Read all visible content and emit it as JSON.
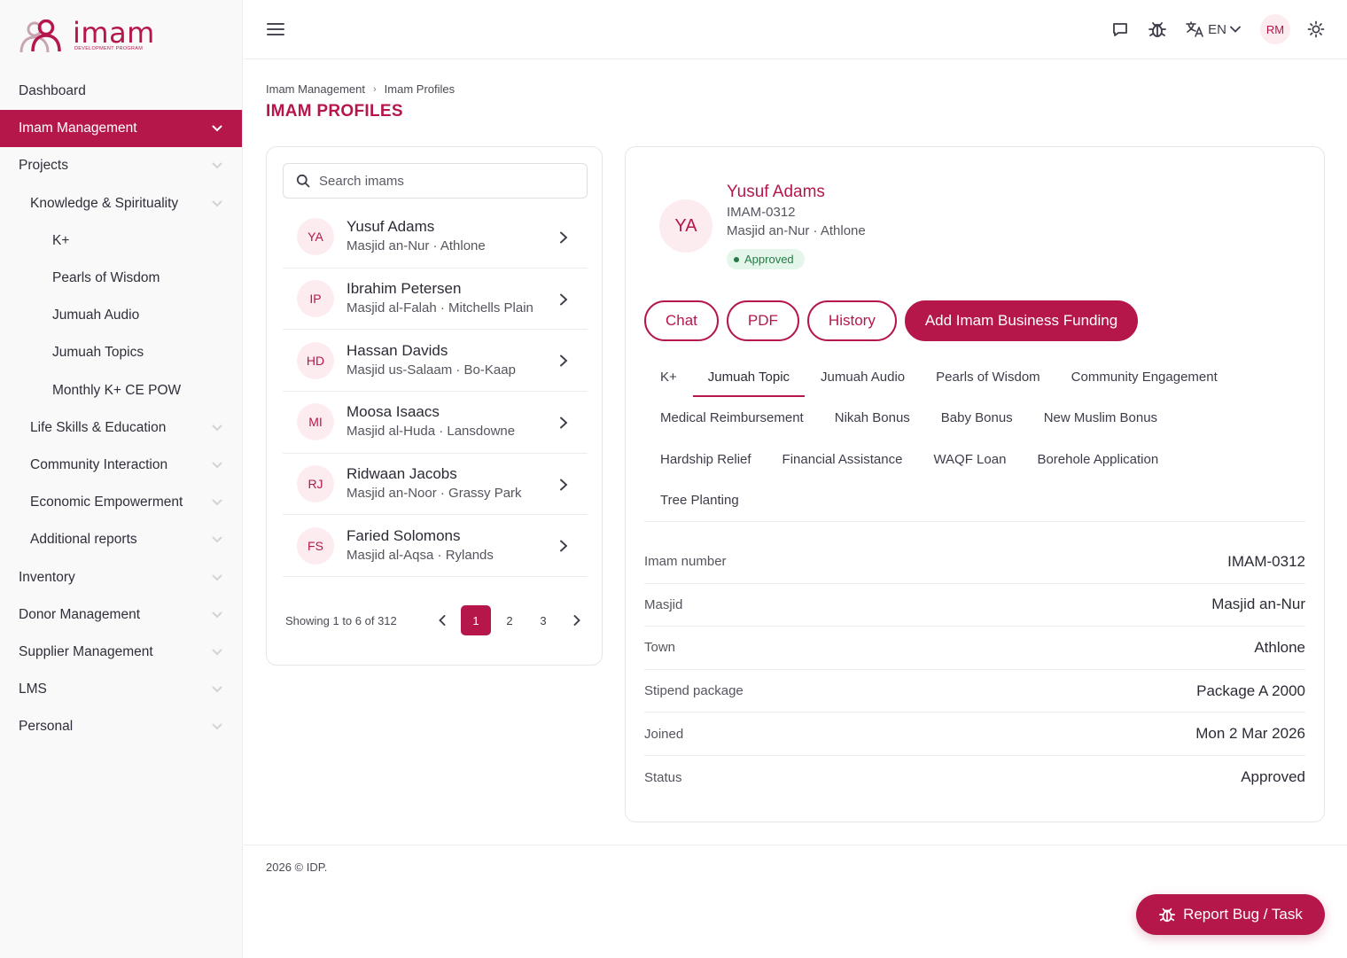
{
  "brand": {
    "name": "imam",
    "tagline": "DEVELOPMENT PROGRAM",
    "accent_color": "#b5174b"
  },
  "sidebar": {
    "items": [
      {
        "label": "Dashboard",
        "level": 1,
        "chevron": false,
        "active": false
      },
      {
        "label": "Imam Management",
        "level": 1,
        "chevron": true,
        "active": true
      },
      {
        "label": "Projects",
        "level": 1,
        "chevron": true,
        "active": false
      },
      {
        "label": "Knowledge & Spirituality",
        "level": 2,
        "chevron": true,
        "active": false
      },
      {
        "label": "K+",
        "level": 3,
        "chevron": false,
        "active": false
      },
      {
        "label": "Pearls of Wisdom",
        "level": 3,
        "chevron": false,
        "active": false
      },
      {
        "label": "Jumuah Audio",
        "level": 3,
        "chevron": false,
        "active": false
      },
      {
        "label": "Jumuah Topics",
        "level": 3,
        "chevron": false,
        "active": false
      },
      {
        "label": "Monthly K+ CE POW",
        "level": 3,
        "chevron": false,
        "active": false
      },
      {
        "label": "Life Skills & Education",
        "level": 2,
        "chevron": true,
        "active": false
      },
      {
        "label": "Community Interaction",
        "level": 2,
        "chevron": true,
        "active": false
      },
      {
        "label": "Economic Empowerment",
        "level": 2,
        "chevron": true,
        "active": false
      },
      {
        "label": "Additional reports",
        "level": 2,
        "chevron": true,
        "active": false
      },
      {
        "label": "Inventory",
        "level": 1,
        "chevron": true,
        "active": false
      },
      {
        "label": "Donor Management",
        "level": 1,
        "chevron": true,
        "active": false
      },
      {
        "label": "Supplier Management",
        "level": 1,
        "chevron": true,
        "active": false
      },
      {
        "label": "LMS",
        "level": 1,
        "chevron": true,
        "active": false
      },
      {
        "label": "Personal",
        "level": 1,
        "chevron": true,
        "active": false
      }
    ]
  },
  "header": {
    "language": "EN",
    "user_initials": "RM",
    "icons": [
      "menu-icon",
      "chat-icon",
      "bug-icon",
      "translate-icon",
      "chevron-down-icon",
      "sun-icon"
    ]
  },
  "breadcrumb": {
    "items": [
      "Imam Management",
      "Imam Profiles"
    ],
    "separator": "›"
  },
  "page_title": "IMAM PROFILES",
  "search": {
    "placeholder": "Search imams",
    "value": ""
  },
  "imams": [
    {
      "initials": "YA",
      "name": "Yusuf Adams",
      "location": "Masjid an-Nur · Athlone"
    },
    {
      "initials": "IP",
      "name": "Ibrahim Petersen",
      "location": "Masjid al-Falah · Mitchells Plain"
    },
    {
      "initials": "HD",
      "name": "Hassan Davids",
      "location": "Masjid us-Salaam · Bo-Kaap"
    },
    {
      "initials": "MI",
      "name": "Moosa Isaacs",
      "location": "Masjid al-Huda · Lansdowne"
    },
    {
      "initials": "RJ",
      "name": "Ridwaan Jacobs",
      "location": "Masjid an-Noor · Grassy Park"
    },
    {
      "initials": "FS",
      "name": "Faried Solomons",
      "location": "Masjid al-Aqsa · Rylands"
    }
  ],
  "pagination": {
    "info": "Showing 1 to 6 of 312",
    "pages": [
      "1",
      "2",
      "3"
    ],
    "current": "1"
  },
  "detail": {
    "initials": "YA",
    "name": "Yusuf Adams",
    "number": "IMAM-0312",
    "location": "Masjid an-Nur · Athlone",
    "status_badge": "Approved",
    "status_color": "#247a45",
    "actions": {
      "chat": "Chat",
      "pdf": "PDF",
      "history": "History",
      "add_funding": "Add Imam Business Funding"
    },
    "tabs": [
      [
        "K+",
        "Jumuah Topic",
        "Jumuah Audio",
        "Pearls of Wisdom",
        "Community Engagement"
      ],
      [
        "Medical Reimbursement",
        "Nikah Bonus",
        "Baby Bonus",
        "New Muslim Bonus"
      ],
      [
        "Hardship Relief",
        "Financial Assistance",
        "WAQF Loan",
        "Borehole Application"
      ],
      [
        "Tree Planting"
      ]
    ],
    "active_tab": "Jumuah Topic",
    "fields": [
      {
        "label": "Imam number",
        "value": "IMAM-0312"
      },
      {
        "label": "Masjid",
        "value": "Masjid an-Nur"
      },
      {
        "label": "Town",
        "value": "Athlone"
      },
      {
        "label": "Stipend package",
        "value": "Package A 2000"
      },
      {
        "label": "Joined",
        "value": "Mon 2 Mar 2026"
      },
      {
        "label": "Status",
        "value": "Approved"
      }
    ]
  },
  "footer": {
    "copyright": "2026 © IDP.",
    "report_button": "Report Bug / Task"
  }
}
